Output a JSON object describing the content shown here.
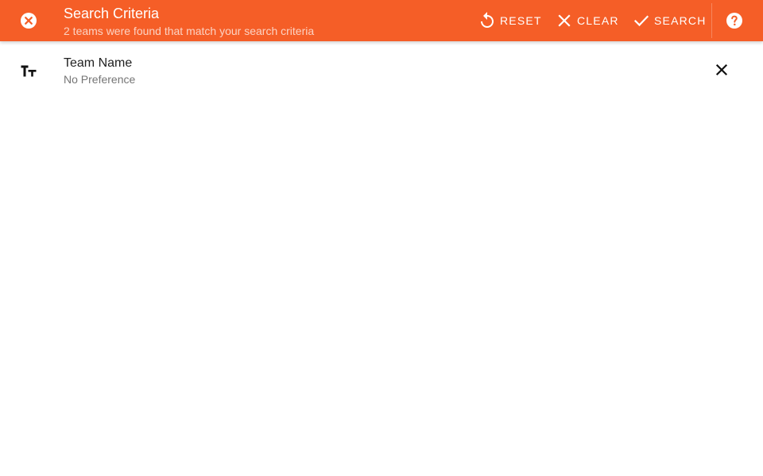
{
  "colors": {
    "app_bar": "#F55E27",
    "on_app_bar": "#FFFFFF",
    "primary_text": "#212121",
    "secondary_text": "#757575"
  },
  "header": {
    "close_icon": "close-circle-icon",
    "title": "Search Criteria",
    "subtitle": "2 teams were found that match your search criteria",
    "actions": [
      {
        "icon": "reset-icon",
        "label": "RESET"
      },
      {
        "icon": "close-icon",
        "label": "CLEAR"
      },
      {
        "icon": "check-icon",
        "label": "SEARCH"
      }
    ],
    "help_icon": "help-circle-icon"
  },
  "criteria": [
    {
      "icon": "text-size-icon",
      "label": "Team Name",
      "value": "No Preference",
      "remove_icon": "close-icon"
    }
  ]
}
